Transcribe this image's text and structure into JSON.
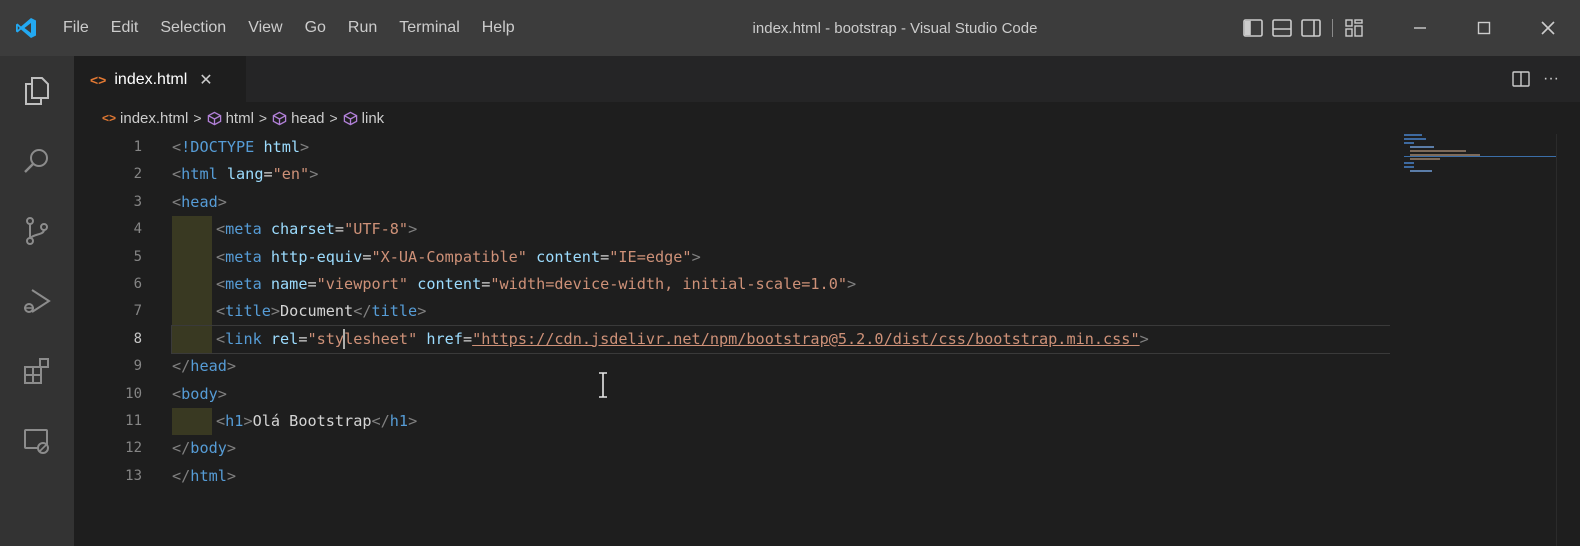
{
  "menu": [
    "File",
    "Edit",
    "Selection",
    "View",
    "Go",
    "Run",
    "Terminal",
    "Help"
  ],
  "window_title": "index.html - bootstrap - Visual Studio Code",
  "tab": {
    "label": "index.html",
    "close": "✕"
  },
  "editor_actions": {
    "more": "···"
  },
  "breadcrumb": [
    "index.html",
    "html",
    "head",
    "link"
  ],
  "line_numbers": [
    "1",
    "2",
    "3",
    "4",
    "5",
    "6",
    "7",
    "8",
    "9",
    "10",
    "11",
    "12",
    "13"
  ],
  "active_line": "8",
  "code": {
    "doctype": "<!DOCTYPE html>",
    "html_lang_value": "\"en\"",
    "charset_value": "\"UTF-8\"",
    "http_equiv_value": "\"X-UA-Compatible\"",
    "content_ie_value": "\"IE=edge\"",
    "viewport_value": "\"viewport\"",
    "viewport_content_value": "\"width=device-width, initial-scale=1.0\"",
    "title_text": "Document",
    "rel_value_a": "\"sty",
    "rel_value_b": "lesheet\"",
    "href_value": "\"https://cdn.jsdelivr.net/npm/bootstrap@5.2.0/dist/css/bootstrap.min.css\"",
    "h1_text": "Olá Bootstrap"
  },
  "colors": {
    "titlebar": "#3c3c3c",
    "activitybar": "#333333",
    "editor_bg": "#1e1e1e",
    "tag": "#569cd6",
    "attribute": "#9cdcfe",
    "string": "#ce9178",
    "bracket": "#808080",
    "vscode_blue": "#23a9f2"
  }
}
